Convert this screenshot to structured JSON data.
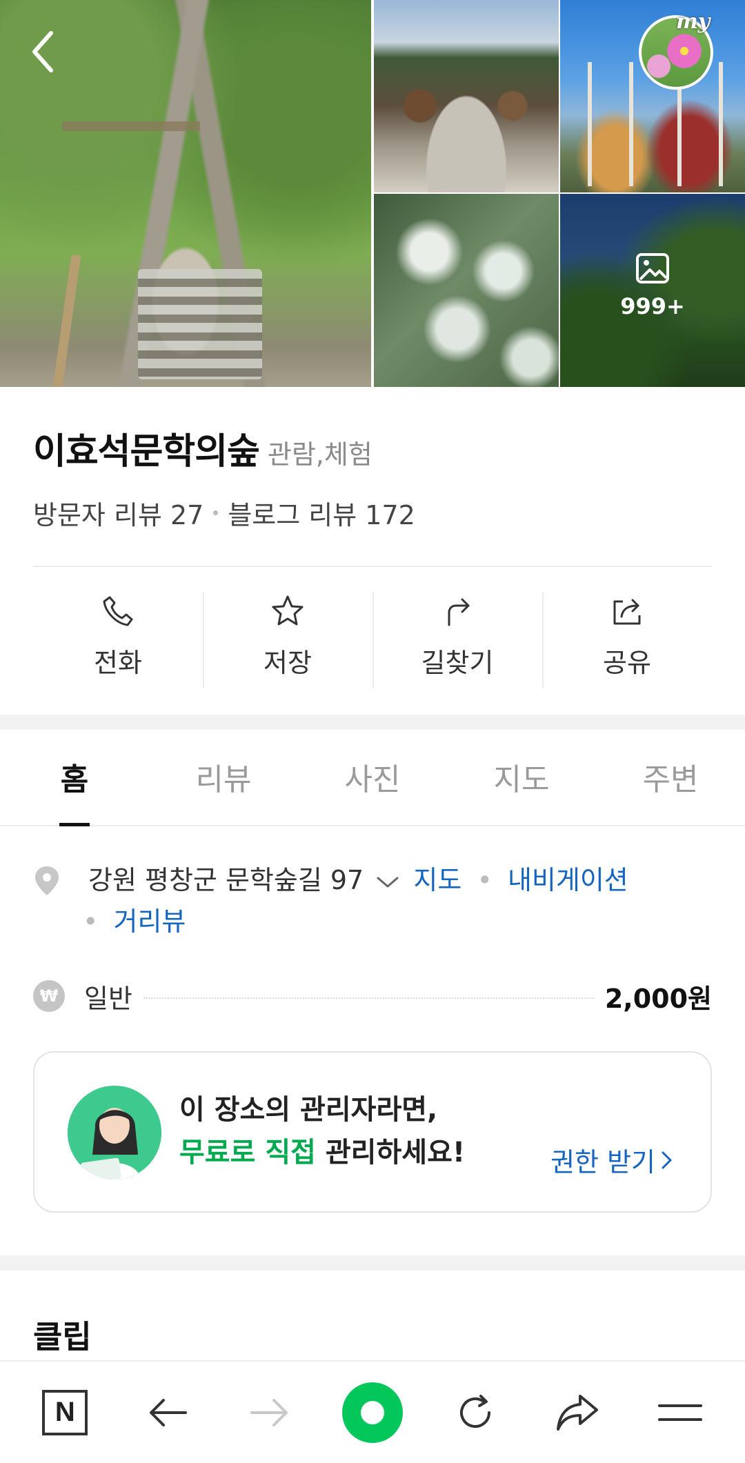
{
  "gallery": {
    "more_count": "999+",
    "my_label": "my"
  },
  "place": {
    "name": "이효석문학의숲",
    "category": "관람,체험",
    "visitor_reviews": "방문자 리뷰 27",
    "blog_reviews": "블로그 리뷰 172"
  },
  "actions": [
    {
      "label": "전화",
      "icon": "phone-icon"
    },
    {
      "label": "저장",
      "icon": "star-icon"
    },
    {
      "label": "길찾기",
      "icon": "directions-icon"
    },
    {
      "label": "공유",
      "icon": "share-icon"
    }
  ],
  "tabs": [
    {
      "label": "홈",
      "active": true
    },
    {
      "label": "리뷰",
      "active": false
    },
    {
      "label": "사진",
      "active": false
    },
    {
      "label": "지도",
      "active": false
    },
    {
      "label": "주변",
      "active": false
    }
  ],
  "info": {
    "address": "강원 평창군 문학숲길 97",
    "map_link": "지도",
    "navigation_link": "내비게이션",
    "street_view_link": "거리뷰",
    "price_label": "일반",
    "price_value": "2,000원",
    "won_symbol": "₩"
  },
  "owner_card": {
    "line1": "이 장소의 관리자라면,",
    "highlight": "무료로 직접",
    "line2_rest": " 관리하세요!",
    "link": "권한 받기"
  },
  "section": {
    "clip_title": "클립"
  },
  "bottom_bar": {
    "n_label": "N"
  },
  "colors": {
    "link": "#1565c0",
    "naver_green": "#03c75a",
    "highlight_green": "#03a94e"
  }
}
